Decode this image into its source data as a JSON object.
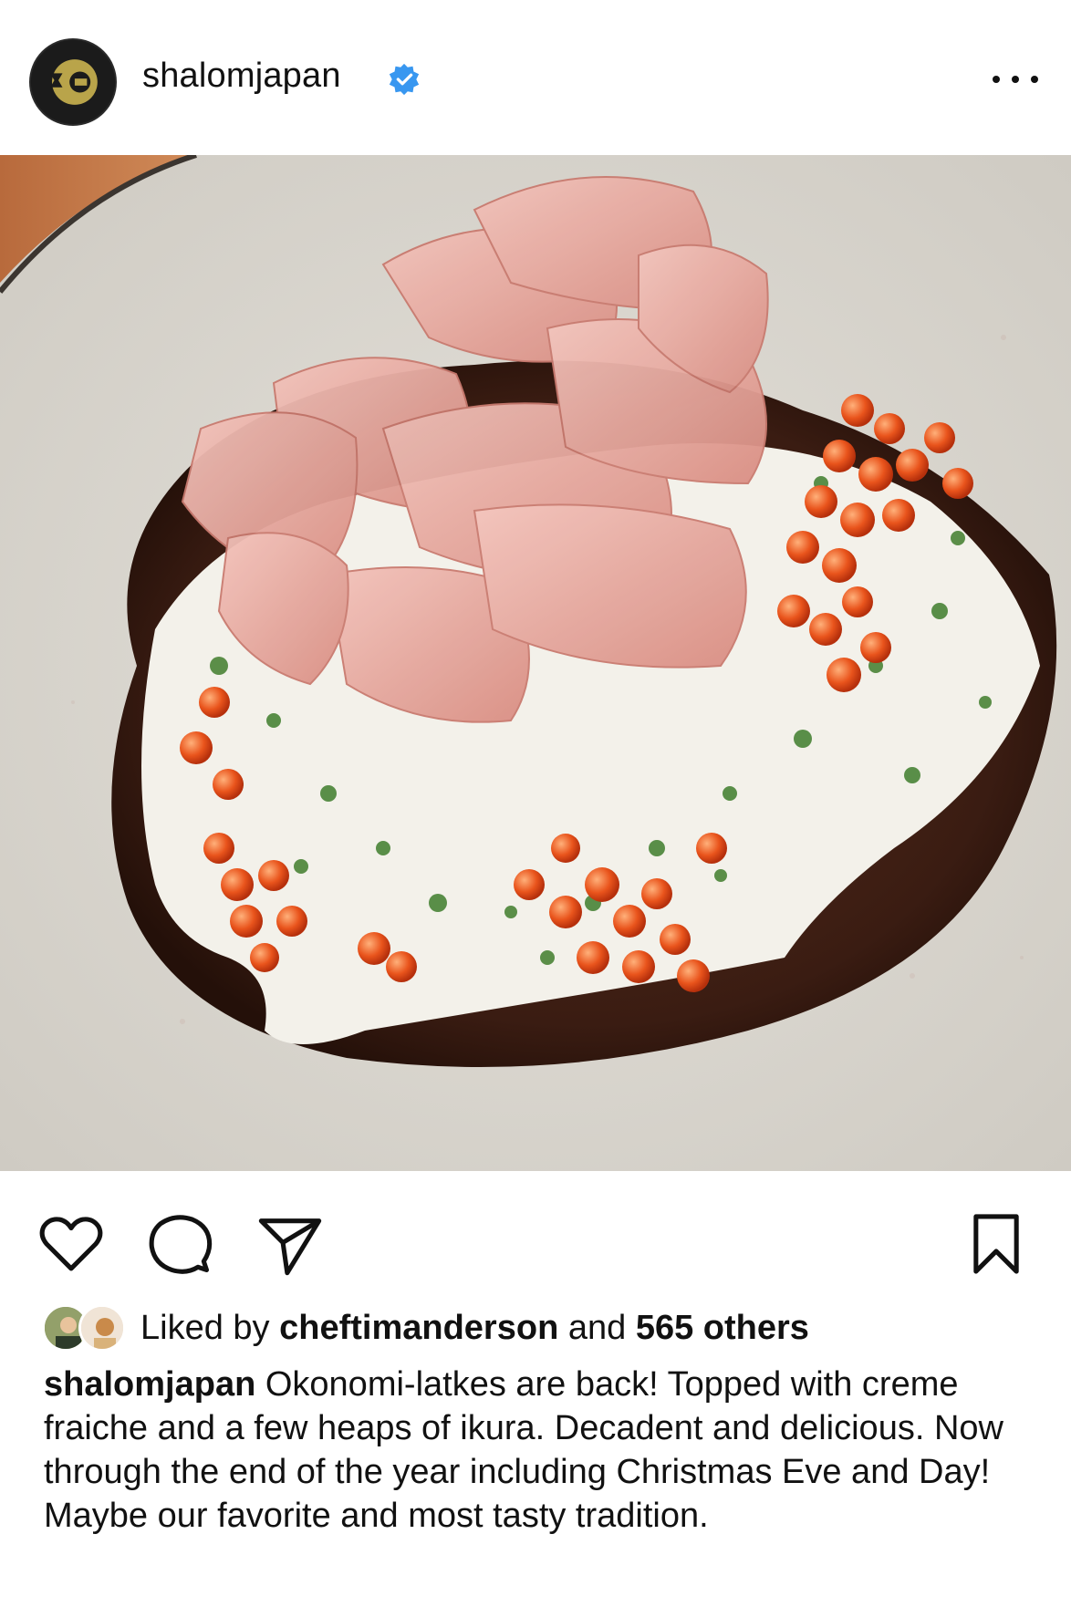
{
  "post": {
    "username": "shalomjapan",
    "verified": true,
    "more_icon": "ellipsis-icon"
  },
  "actions": {
    "like_icon": "heart-icon",
    "comment_icon": "comment-bubble-icon",
    "share_icon": "send-paper-plane-icon",
    "save_icon": "bookmark-icon"
  },
  "likes": {
    "prefix": "Liked by",
    "user": "cheftimanderson",
    "conj": "and",
    "others": "565 others"
  },
  "caption": {
    "username": "shalomjapan",
    "text": "Okonomi-latkes are back! Topped with creme fraiche and a few heaps of ikura. Decadent and delicious. Now through the end of the year including Christmas Eve and Day!  Maybe our favorite and most tasty tradition."
  },
  "colors": {
    "verified_blue": "#3897f0",
    "text": "#111111"
  }
}
